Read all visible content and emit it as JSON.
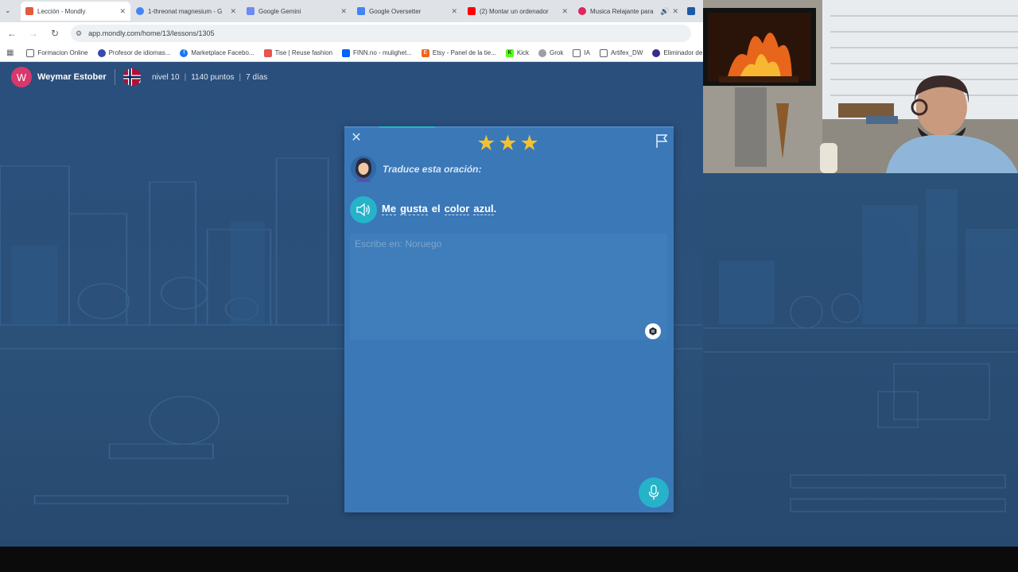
{
  "browser": {
    "tabs": [
      {
        "title": "Lección - Mondly",
        "icon": "mondly-icon",
        "color": "#e35a3c",
        "active": true
      },
      {
        "title": "1-threonat magnesium - G",
        "icon": "google-icon",
        "color": "#4285f4",
        "active": false
      },
      {
        "title": "Google Gemini",
        "icon": "gemini-icon",
        "color": "#6d8bf0",
        "active": false
      },
      {
        "title": "Google Oversetter",
        "icon": "google-translate-icon",
        "color": "#4285f4",
        "active": false
      },
      {
        "title": "(2) Montar un ordenador",
        "icon": "youtube-icon",
        "color": "#ff0000",
        "active": false
      },
      {
        "title": "Musica Relajante para",
        "icon": "music-icon",
        "color": "#e0245e",
        "active": false
      }
    ],
    "url": "app.mondly.com/home/13/lessons/1305",
    "bookmarks": [
      {
        "label": "Formacion Online",
        "icon": "folder-icon"
      },
      {
        "label": "Profesor de idiomas...",
        "icon": "profesor-icon"
      },
      {
        "label": "Marketplace Facebo...",
        "icon": "facebook-icon"
      },
      {
        "label": "Tise | Reuse fashion",
        "icon": "tise-icon"
      },
      {
        "label": "FINN.no - mulighet...",
        "icon": "finn-icon"
      },
      {
        "label": "Etsy - Panel de la tie...",
        "icon": "etsy-icon"
      },
      {
        "label": "Kick",
        "icon": "kick-icon"
      },
      {
        "label": "Grok",
        "icon": "grok-icon"
      },
      {
        "label": "IA",
        "icon": "folder-icon"
      },
      {
        "label": "Artifex_DW",
        "icon": "folder-icon"
      },
      {
        "label": "Eliminador de",
        "icon": "eliminador-icon"
      }
    ]
  },
  "user": {
    "avatar_letter": "W",
    "name": "Weymar Estober",
    "language_flag": "norway-flag-icon",
    "level": "nivel 10",
    "points": "1140 puntos",
    "streak": "7 días"
  },
  "lesson": {
    "progress": 0.17,
    "stars": "★★★",
    "instruction": "Traduce esta oración:",
    "sentence_words": [
      "Me",
      "gusta",
      "el",
      "color",
      "azul"
    ],
    "sentence_end": ".",
    "answer_placeholder": "Escribe en: Noruego",
    "answer_value": ""
  },
  "colors": {
    "accent": "#26b3c9",
    "card": "#3a78b8",
    "star": "#f1c232",
    "avatar": "#d8386c"
  }
}
